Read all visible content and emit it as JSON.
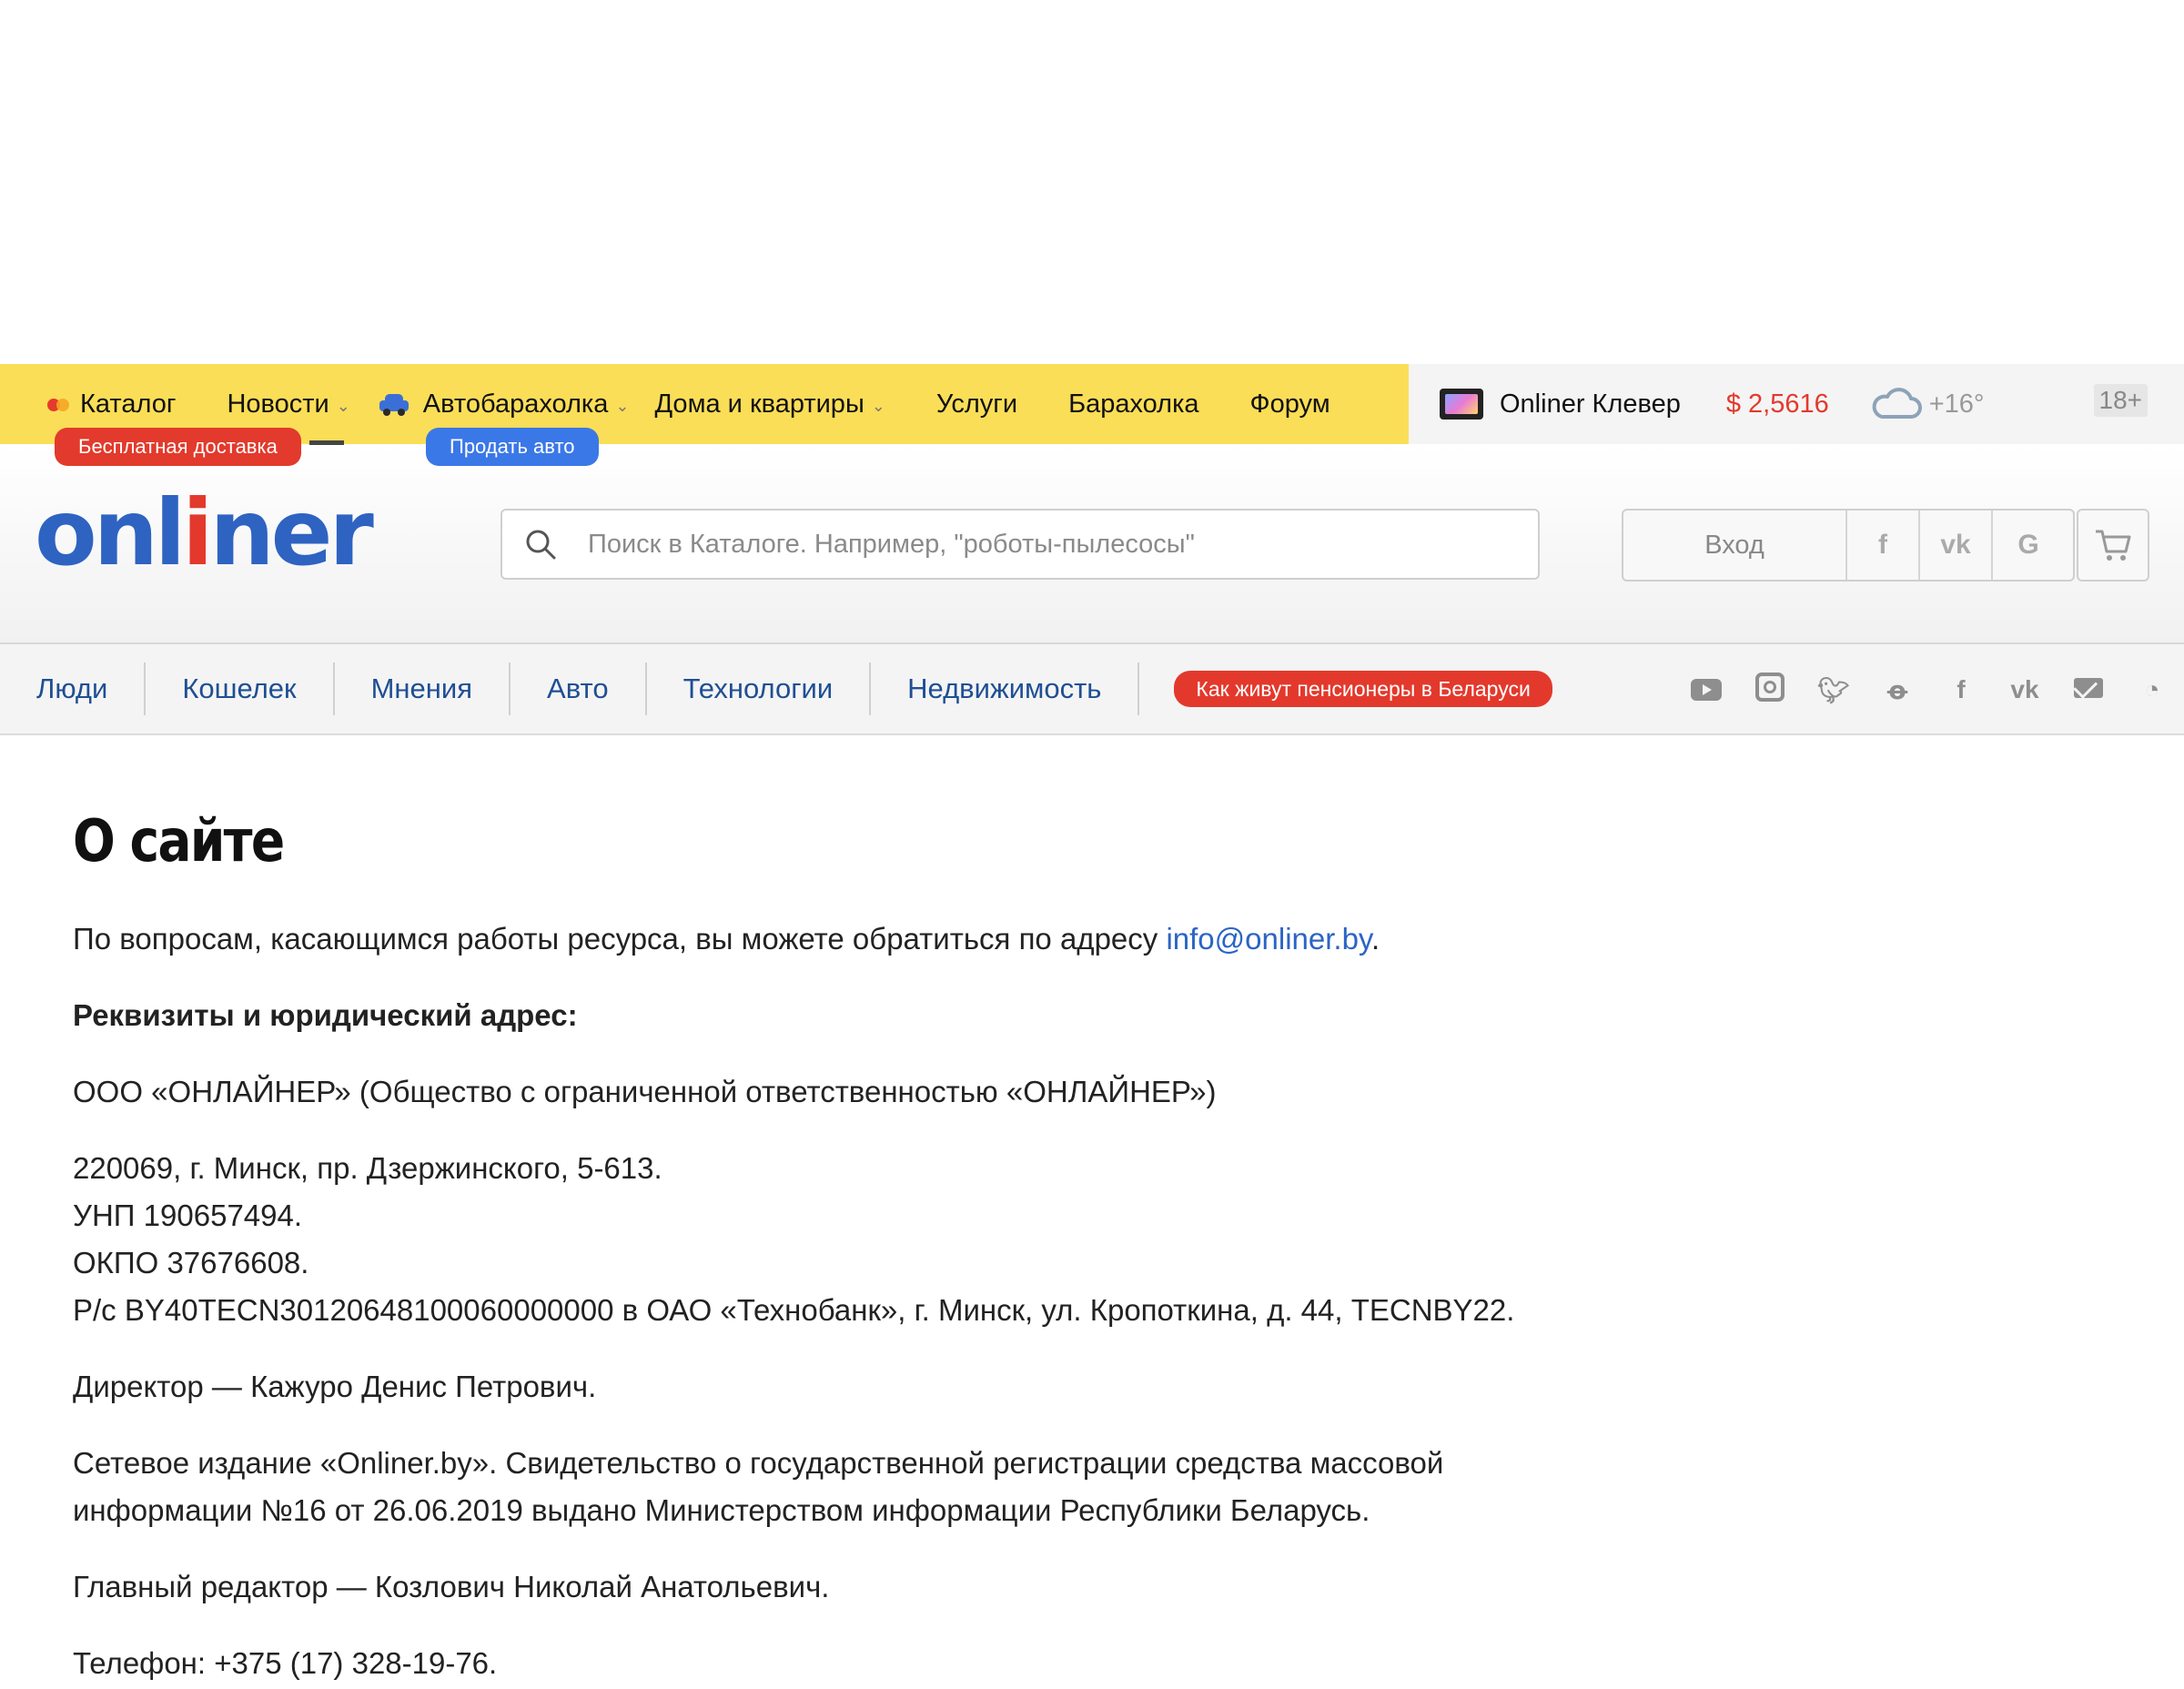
{
  "topbar": {
    "items": [
      {
        "label": "Каталог",
        "badge": "Бесплатная доставка"
      },
      {
        "label": "Новости"
      },
      {
        "label": "Автобарахолка",
        "badge": "Продать авто"
      },
      {
        "label": "Дома и квартиры"
      },
      {
        "label": "Услуги"
      },
      {
        "label": "Барахолка"
      },
      {
        "label": "Форум"
      }
    ],
    "clever": "Onliner Клевер",
    "currency": "$ 2,5616",
    "weather": "+16°",
    "age": "18+",
    "colors": {
      "yellow": "#fbde57",
      "red": "#e3392c",
      "blue": "#3b78e7"
    }
  },
  "header": {
    "logo": {
      "a": "onl",
      "b": "i",
      "c": "ner"
    },
    "search_placeholder": "Поиск в Каталоге. Например, \"роботы-пылесосы\"",
    "login": "Вход",
    "social_login": [
      "f",
      "vk",
      "G"
    ]
  },
  "newsnav": {
    "items": [
      "Люди",
      "Кошелек",
      "Мнения",
      "Авто",
      "Технологии",
      "Недвижимость"
    ],
    "promo": "Как живут пенсионеры в Беларуси",
    "social": [
      "youtube",
      "instagram",
      "twitter",
      "odnoklassniki",
      "facebook",
      "vk",
      "mail",
      "rss"
    ]
  },
  "content": {
    "title": "О сайте",
    "contact_text": "По вопросам, касающимся работы ресурса, вы можете обратиться по адресу ",
    "contact_email": "info@onliner.by",
    "contact_end": ".",
    "requisites_heading": "Реквизиты и юридический адрес:",
    "company": "ООО «ОНЛАЙНЕР» (Общество с ограниченной ответственностью «ОНЛАЙНЕР»)",
    "address": "220069, г. Минск, пр. Дзержинского, 5-613.",
    "unp": "УНП 190657494.",
    "okpo": "ОКПО 37676608.",
    "account": "Р/с BY40TECN30120648100060000000 в ОАО «Технобанк», г. Минск, ул. Кропоткина, д. 44, TECNBY22.",
    "director": "Директор — Кажуро Денис Петрович.",
    "media_line1": "Сетевое издание «Onliner.by». Свидетельство о государственной регистрации средства массовой",
    "media_line2": "информации №16 от 26.06.2019 выдано Министерством информации Республики Беларусь.",
    "editor": "Главный редактор — Козлович Николай Анатольевич.",
    "phone": "Телефон: +375 (17) 328-19-76."
  }
}
